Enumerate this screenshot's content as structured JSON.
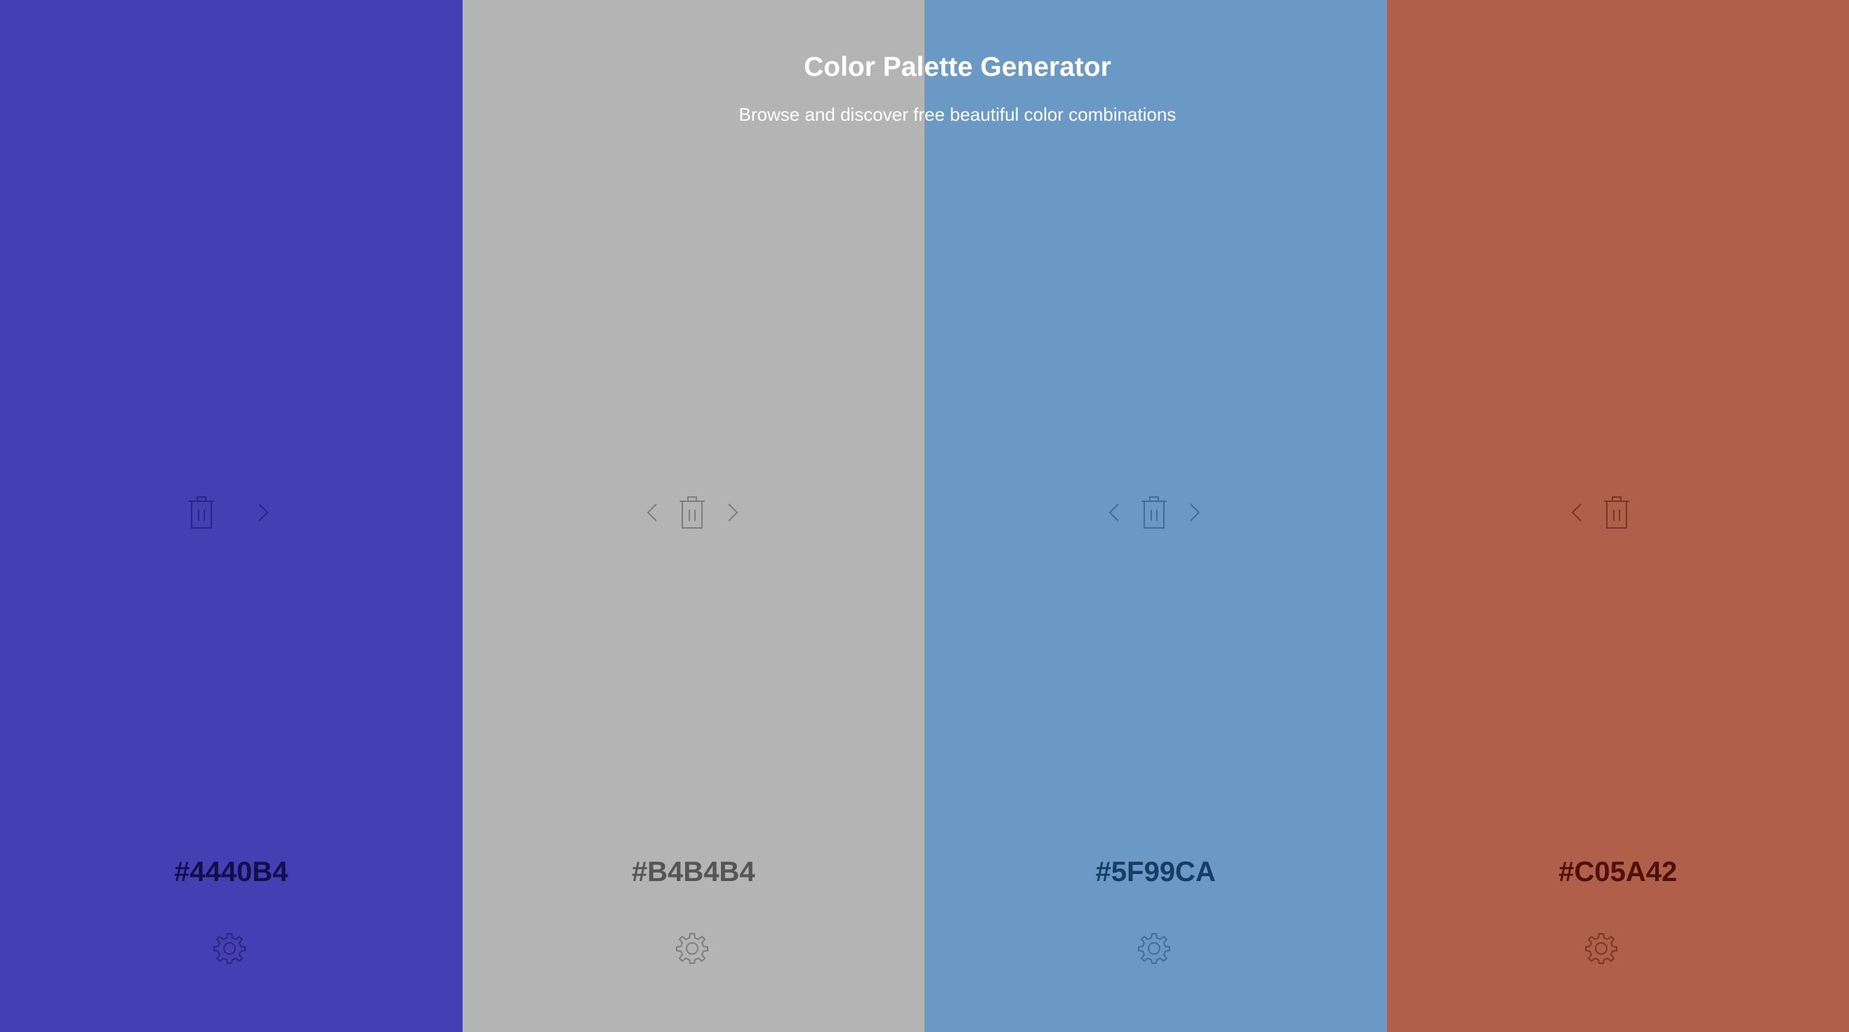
{
  "header": {
    "title": "Color Palette Generator",
    "subtitle": "Browse and discover free beautiful color combinations"
  },
  "palette": [
    {
      "hex": "#4440B4",
      "background": "#4440B4",
      "foreground": "#12104a",
      "icon_color": "#2a2680",
      "controls": [
        "trash-icon",
        "chevron-right-icon"
      ]
    },
    {
      "hex": "#B4B4B4",
      "background": "#B4B4B4",
      "foreground": "#555555",
      "icon_color": "#7d7d7d",
      "controls": [
        "chevron-left-icon",
        "trash-icon",
        "chevron-right-icon"
      ]
    },
    {
      "hex": "#5F99CA",
      "background": "#6B99C6",
      "foreground": "#143e66",
      "icon_color": "#3e6e9c",
      "controls": [
        "chevron-left-icon",
        "trash-icon",
        "chevron-right-icon"
      ]
    },
    {
      "hex": "#C05A42",
      "background": "#B0604A",
      "foreground": "#4f1008",
      "icon_color": "#7d3426",
      "controls": [
        "chevron-left-icon",
        "trash-icon"
      ]
    }
  ]
}
